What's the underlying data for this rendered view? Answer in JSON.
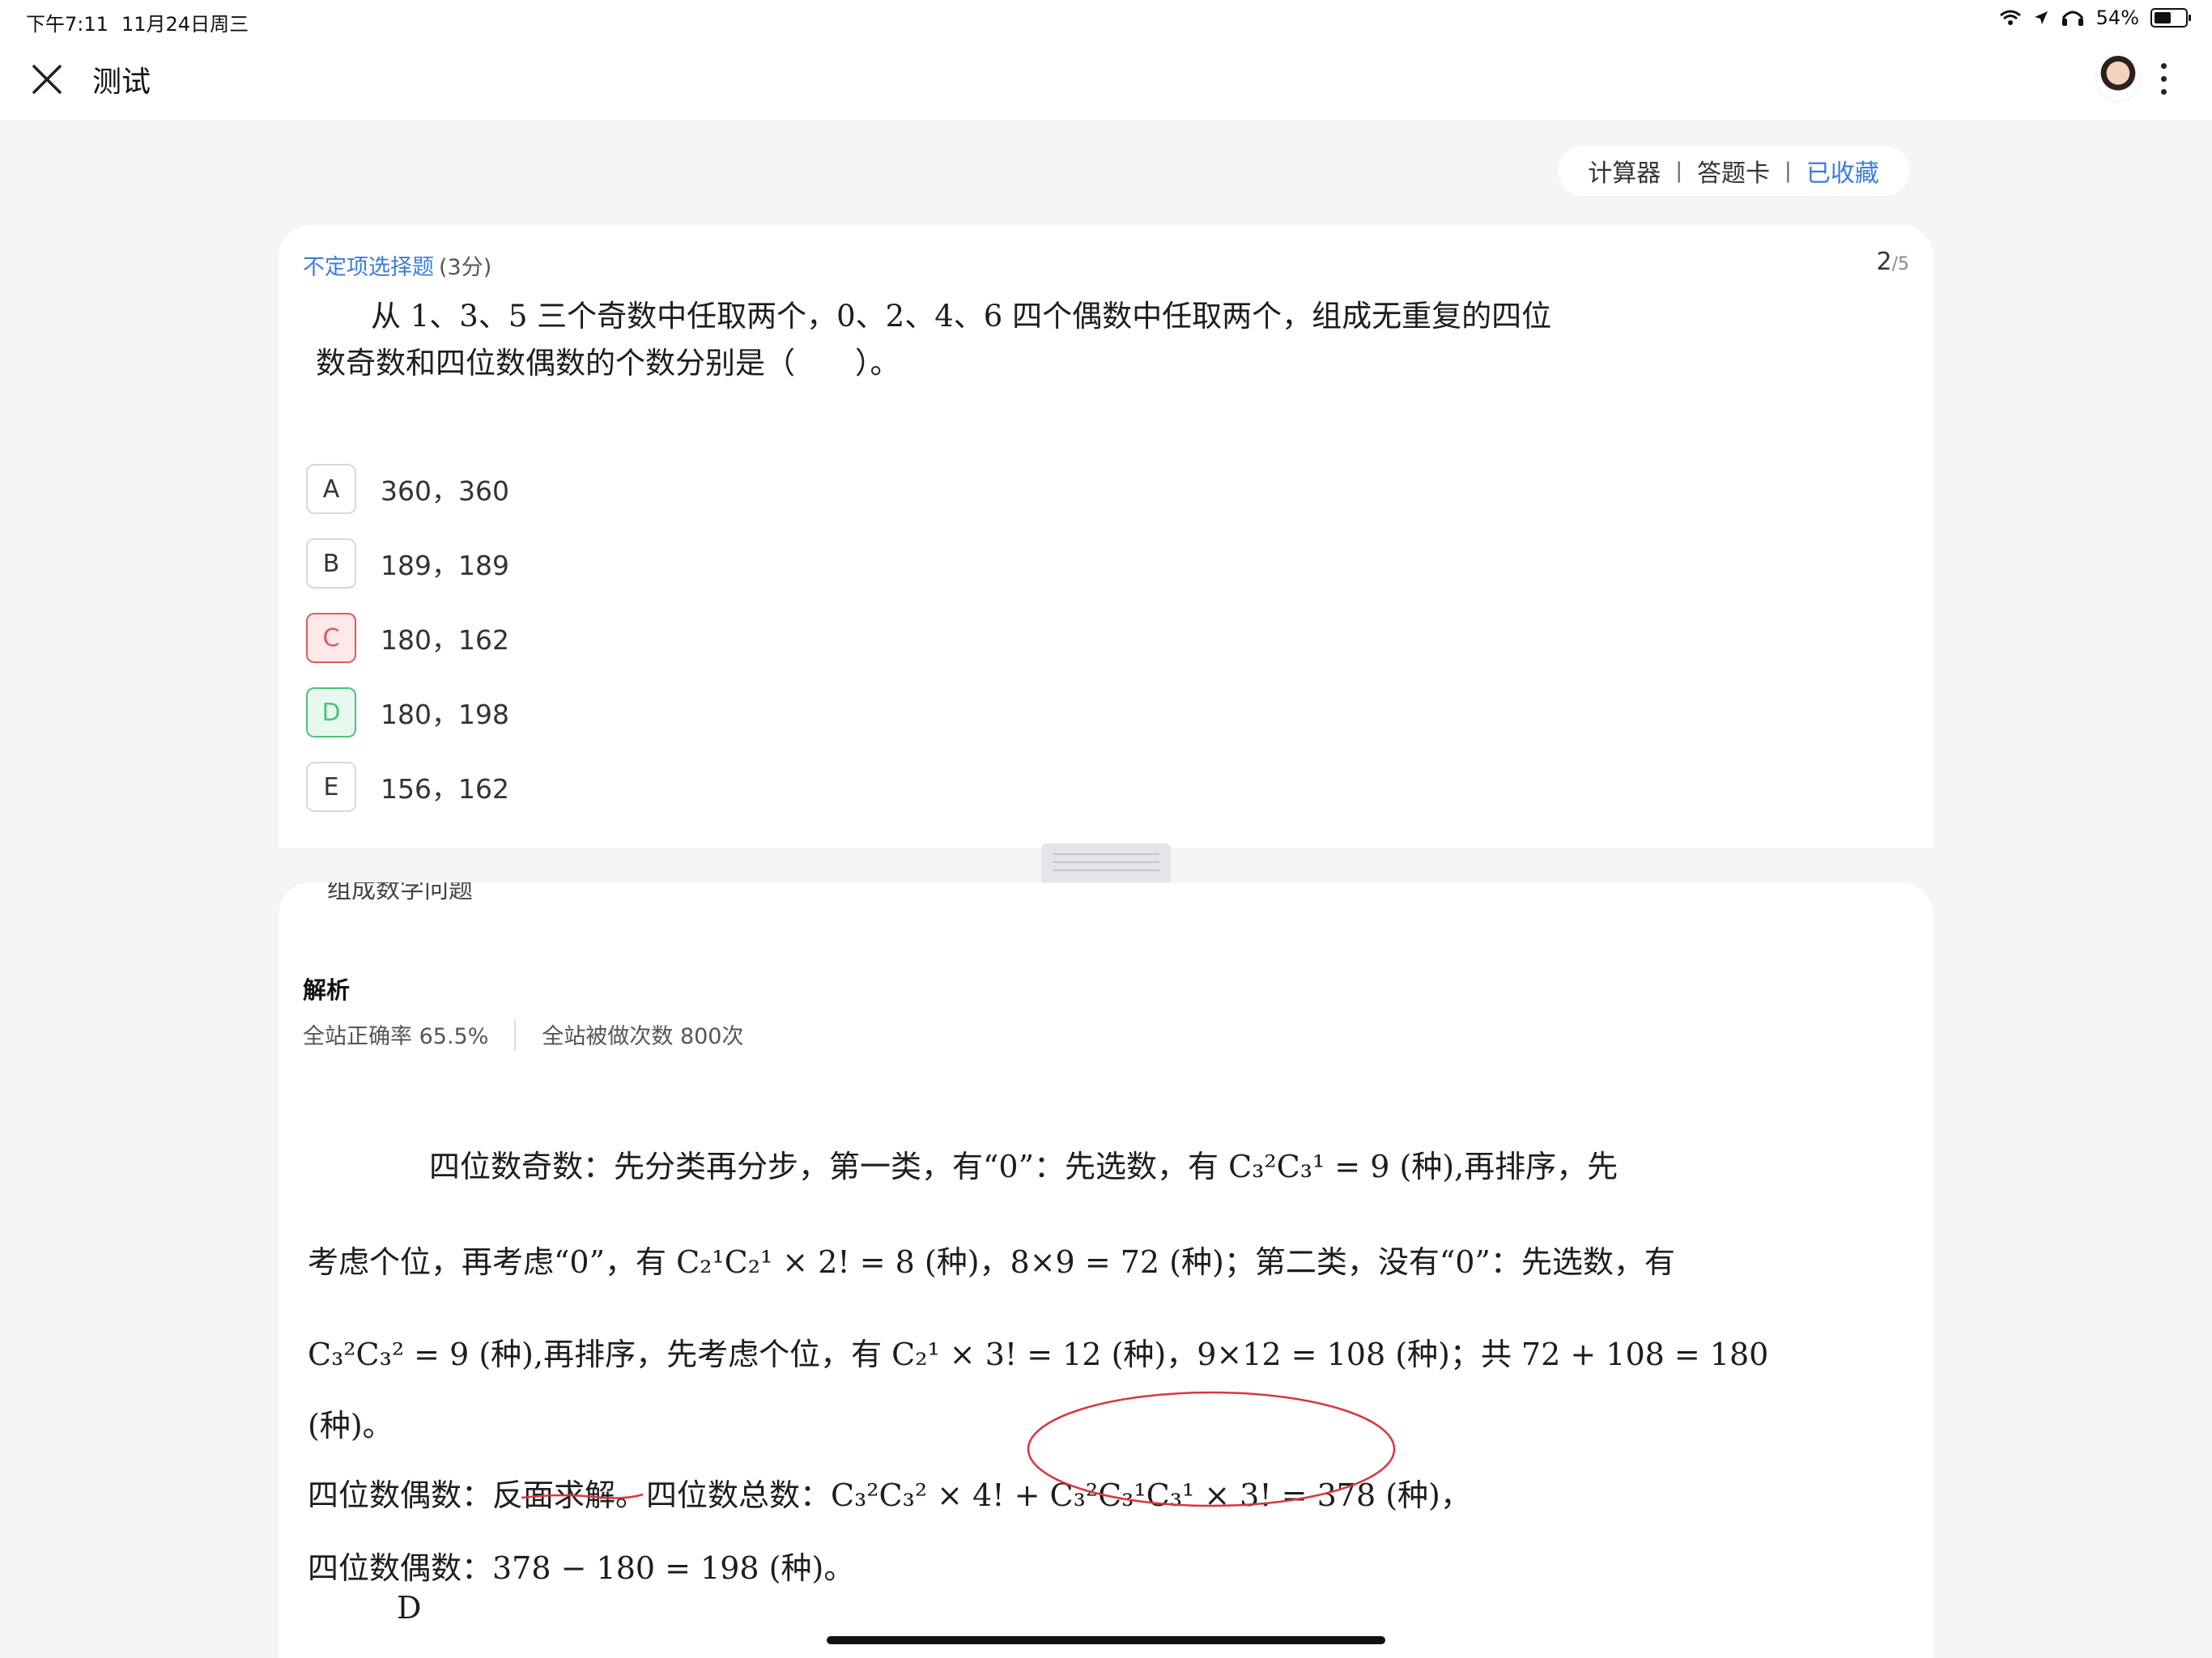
{
  "status_bar": {
    "time": "下午7:11",
    "date": "11月24日周三",
    "battery": "54%"
  },
  "header": {
    "title": "测试"
  },
  "tools": {
    "calculator": "计算器",
    "answer_card": "答题卡",
    "favorited": "已收藏",
    "separator": "|"
  },
  "question": {
    "type": "不定项选择题",
    "score": "(3分)",
    "current": "2",
    "total": "/5",
    "text_line1": "从 1、3、5 三个奇数中任取两个，0、2、4、6 四个偶数中任取两个，组成无重复的四位",
    "text_line2": "数奇数和四位数偶数的个数分别是（　　）。",
    "options": [
      {
        "letter": "A",
        "text": "360，360",
        "state": "normal"
      },
      {
        "letter": "B",
        "text": "189，189",
        "state": "normal"
      },
      {
        "letter": "C",
        "text": "180，162",
        "state": "wrong"
      },
      {
        "letter": "D",
        "text": "180，198",
        "state": "correct"
      },
      {
        "letter": "E",
        "text": "156，162",
        "state": "normal"
      }
    ]
  },
  "analysis": {
    "cut_text": "组成数字问题",
    "title": "解析",
    "accuracy": "全站正确率 65.5%",
    "attempts": "全站被做次数 800次",
    "lines": [
      "四位数奇数：先分类再分步，第一类，有“0”：先选数，有 C₃²C₃¹ = 9 (种),再排序，先",
      "考虑个位，再考虑“0”，有 C₂¹C₂¹ × 2! = 8 (种)，8×9 = 72 (种)；第二类，没有“0”：先选数，有",
      "C₃²C₃² = 9 (种),再排序，先考虑个位，有 C₂¹ × 3! = 12 (种)，9×12 = 108 (种)；共 72 + 108 = 180",
      "(种)。",
      "四位数偶数：反面求解。四位数总数：C₃²C₃² × 4! + C₃²C₃¹C₃¹ × 3! = 378 (种)，",
      "四位数偶数：378 − 180 = 198 (种)。",
      "D"
    ]
  }
}
